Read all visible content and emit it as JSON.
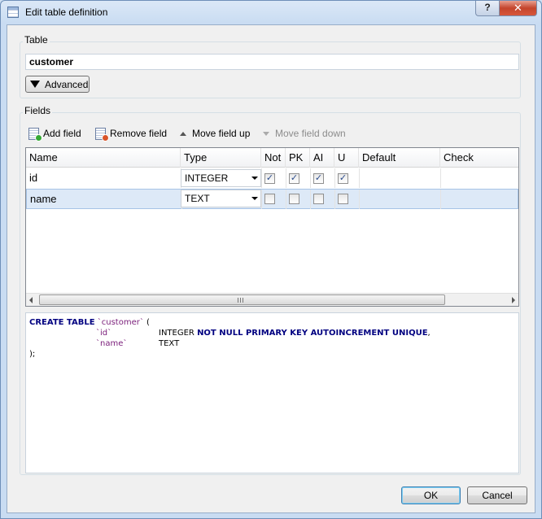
{
  "window": {
    "title": "Edit table definition",
    "help_label": "?",
    "close_label": "✕"
  },
  "table_group": {
    "label": "Table",
    "name_value": "customer",
    "advanced_label": "Advanced"
  },
  "fields_group": {
    "label": "Fields",
    "toolbar": {
      "add_field": "Add field",
      "remove_field": "Remove field",
      "move_up": "Move field up",
      "move_down": "Move field down"
    },
    "columns": [
      "Name",
      "Type",
      "Not",
      "PK",
      "AI",
      "U",
      "Default",
      "Check"
    ],
    "rows": [
      {
        "name": "id",
        "type": "INTEGER",
        "not_null": true,
        "pk": true,
        "ai": true,
        "unique": true,
        "default": "",
        "check": ""
      },
      {
        "name": "name",
        "type": "TEXT",
        "not_null": false,
        "pk": false,
        "ai": false,
        "unique": false,
        "default": "",
        "check": ""
      }
    ],
    "scroll_grip": "|||"
  },
  "sql": {
    "l1_kw": "CREATE TABLE",
    "l1_ident": "`customer`",
    "l1_rest": "(",
    "l2_ident": "`id`",
    "l2_type": "INTEGER",
    "l2_kw": "NOT NULL PRIMARY KEY AUTOINCREMENT UNIQUE",
    "l2_rest": ",",
    "l3_ident": "`name`",
    "l3_type": "TEXT",
    "l4": ");"
  },
  "buttons": {
    "ok": "OK",
    "cancel": "Cancel"
  },
  "colors": {
    "keyword": "#000080",
    "identifier": "#7a1d7a",
    "selected_row": "#dde9f7"
  }
}
